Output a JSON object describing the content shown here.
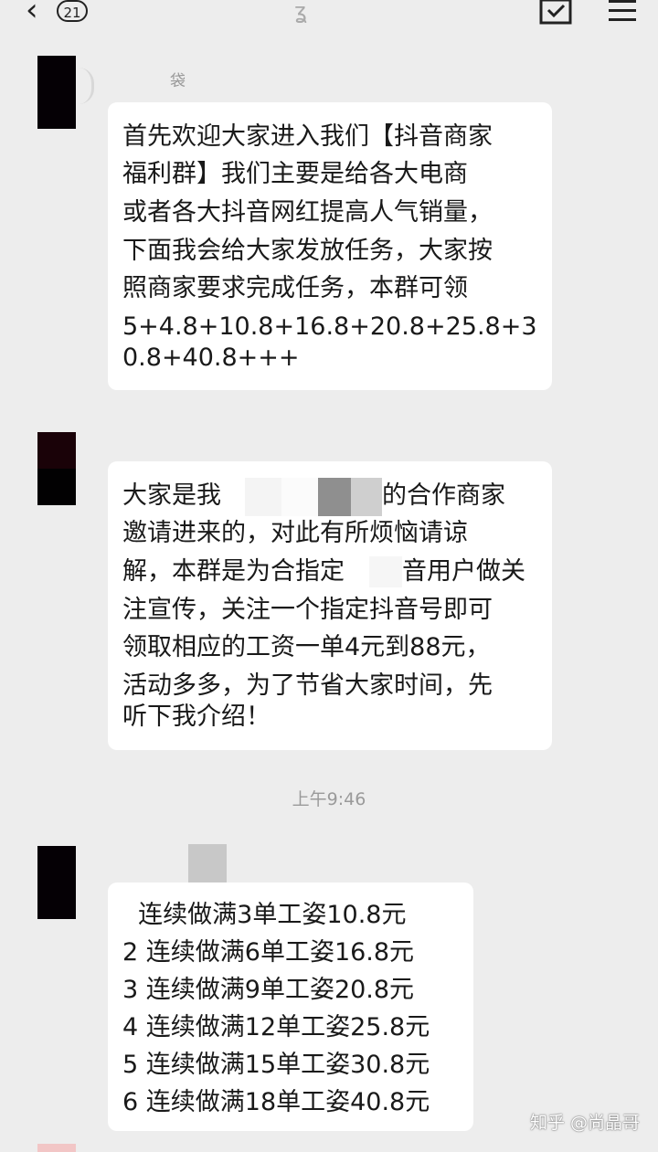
{
  "nav": {
    "unread_count": "21"
  },
  "messages": [
    {
      "sender": "袋",
      "lines": [
        "首先欢迎大家进入我们【抖音商家",
        "福利群】我们主要是给各大电商",
        "或者各大抖音网红提高人气销量，",
        "下面我会给大家发放任务，大家按",
        "照商家要求完成任务，本群可领",
        "5+4.8+10.8+16.8+20.8+25.8+3",
        "0.8+40.8+++"
      ]
    },
    {
      "sender": "",
      "lines": [
        "大家是我",
        "邀请进来的，对此有所烦恼请谅",
        "解，本群是为合指定",
        "注宣传，关注一个指定抖音号即可",
        "领取相应的工资一单4元到88元，",
        "活动多多，为了节省大家时间，先",
        "听下我介绍！"
      ],
      "line1_tail": "的合作商家",
      "line3_tail": "音用户做关"
    },
    {
      "sender": "",
      "lines": [
        "  连续做满3单工姿10.8元",
        "2 连续做满6单工姿16.8元",
        "3 连续做满9单工姿20.8元",
        "4 连续做满12单工姿25.8元",
        "5 连续做满15单工姿30.8元",
        "6 连续做满18单工姿40.8元"
      ]
    }
  ],
  "timestamp": "上午9:46",
  "watermark": "知乎 @尚晶哥"
}
